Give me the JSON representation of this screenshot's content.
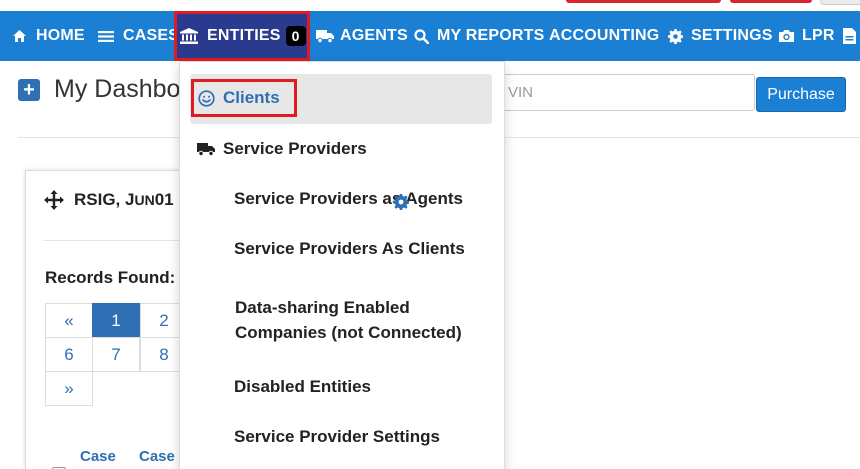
{
  "nav": {
    "items": [
      {
        "label": "HOME",
        "icon": "home-icon"
      },
      {
        "label": "CASES",
        "icon": "list-icon"
      },
      {
        "label": "ENTITIES",
        "icon": "bank-icon",
        "badge": "0"
      },
      {
        "label": "AGENTS",
        "icon": "truck-icon"
      },
      {
        "label": "MY REPORTS",
        "icon": "search-icon"
      },
      {
        "label": "ACCOUNTING",
        "icon": ""
      },
      {
        "label": "SETTINGS",
        "icon": "gear-icon"
      },
      {
        "label": "LPR",
        "icon": "camera-icon"
      }
    ]
  },
  "dashboard": {
    "title": "My Dashboard",
    "vin_placeholder": "VIN",
    "purchase_label": "Purchase"
  },
  "widget": {
    "title_main": "RSIG, J",
    "title_small": "UN",
    "title_rest": " 01",
    "records_label": "Records Found:",
    "pager": [
      "«",
      "1",
      "2",
      "6",
      "7",
      "8",
      "»"
    ],
    "active_page": "1",
    "columns": [
      "Case",
      "Case"
    ]
  },
  "dropdown": {
    "items": [
      {
        "label": "Clients",
        "icon": "smile-icon"
      },
      {
        "label": "Service Providers",
        "icon": "truck-icon"
      },
      {
        "label": "Service Providers as Agents"
      },
      {
        "label": "Service Providers As Clients"
      },
      {
        "label": "Data-sharing Enabled",
        "label2": "Companies (not Connected)"
      },
      {
        "label": "Disabled Entities"
      },
      {
        "label": "Service Provider Settings"
      }
    ]
  },
  "colors": {
    "navbar": "#1b7fd4",
    "entities_active": "#2a3a8e",
    "highlight_red": "#e01b22",
    "link_blue": "#2f6fb3"
  }
}
